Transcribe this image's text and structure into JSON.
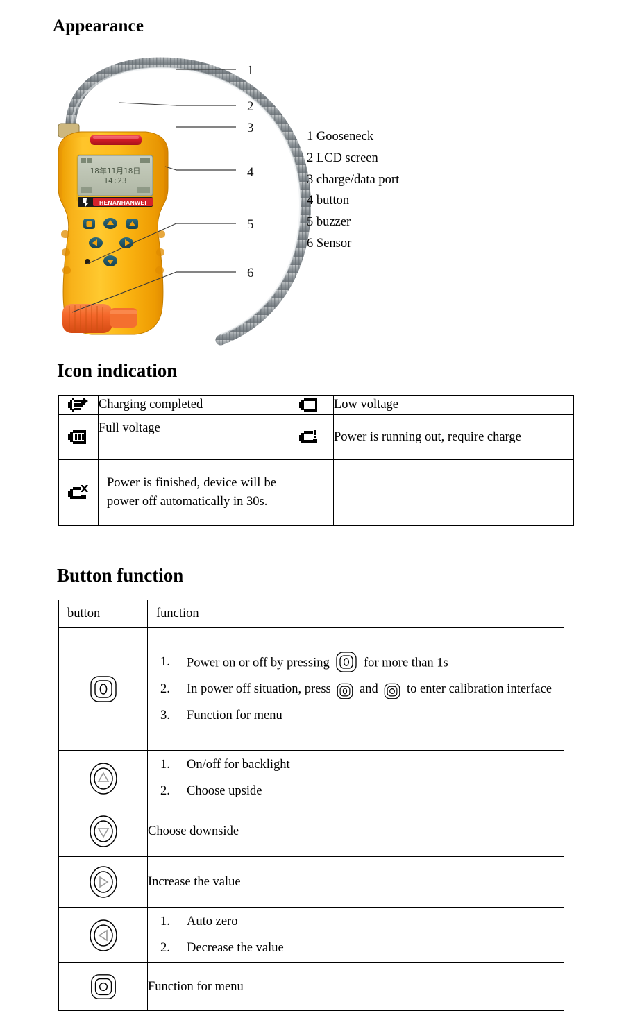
{
  "sections": {
    "appearance_heading": "Appearance",
    "icon_heading": "Icon indication",
    "button_heading": "Button function"
  },
  "figure": {
    "callout_numbers": [
      "1",
      "2",
      "3",
      "4",
      "5",
      "6"
    ],
    "legend": [
      "1 Gooseneck",
      "2 LCD screen",
      "3 charge/data port",
      "4 button",
      "5 buzzer",
      "6 Sensor"
    ],
    "device": {
      "body_color": "#F5A800",
      "body_highlight": "#FFC82E",
      "led_color": "#D81F26",
      "probe_color": "#F4662A",
      "gooseneck_color": "#9AA0A4",
      "brand_label": "HENANHANWEI",
      "lcd": {
        "background": "#BDC4B4",
        "date_line": "18年11月18日",
        "time_line": "14:23"
      }
    }
  },
  "icon_table": {
    "rows": [
      {
        "left_icon": "battery-charging-complete-icon",
        "left_text": "Charging completed",
        "right_icon": "battery-low-icon",
        "right_text": "Low voltage"
      },
      {
        "left_icon": "battery-full-icon",
        "left_text": "Full voltage",
        "right_icon": "battery-warning-icon",
        "right_text": "Power is running out, require charge"
      },
      {
        "left_icon": "battery-empty-icon",
        "left_text": "Power is finished, device will be power off automatically in 30s.",
        "right_icon": "",
        "right_text": ""
      }
    ]
  },
  "button_table": {
    "header": {
      "button": "button",
      "function": "function"
    },
    "rows": [
      {
        "icon": "power-button-icon",
        "items": [
          "Power on or off by pressing   for more than 1s",
          "In power off situation, press   and   to enter calibration interface",
          "Function for menu"
        ],
        "item1_prefix": "Power on or off by pressing",
        "item1_suffix": "for more than 1s",
        "item2_prefix": "In power off situation, press",
        "item2_middle": "and",
        "item2_suffix": "to enter calibration interface",
        "item3": "Function for menu"
      },
      {
        "icon": "arrow-up-button-icon",
        "items": [
          "On/off for backlight",
          "Choose upside"
        ]
      },
      {
        "icon": "arrow-down-button-icon",
        "single": "Choose downside"
      },
      {
        "icon": "arrow-right-button-icon",
        "single": "Increase the value"
      },
      {
        "icon": "arrow-left-button-icon",
        "items": [
          "Auto zero",
          "Decrease the value"
        ]
      },
      {
        "icon": "menu-button-icon",
        "single": "Function for menu"
      }
    ]
  }
}
